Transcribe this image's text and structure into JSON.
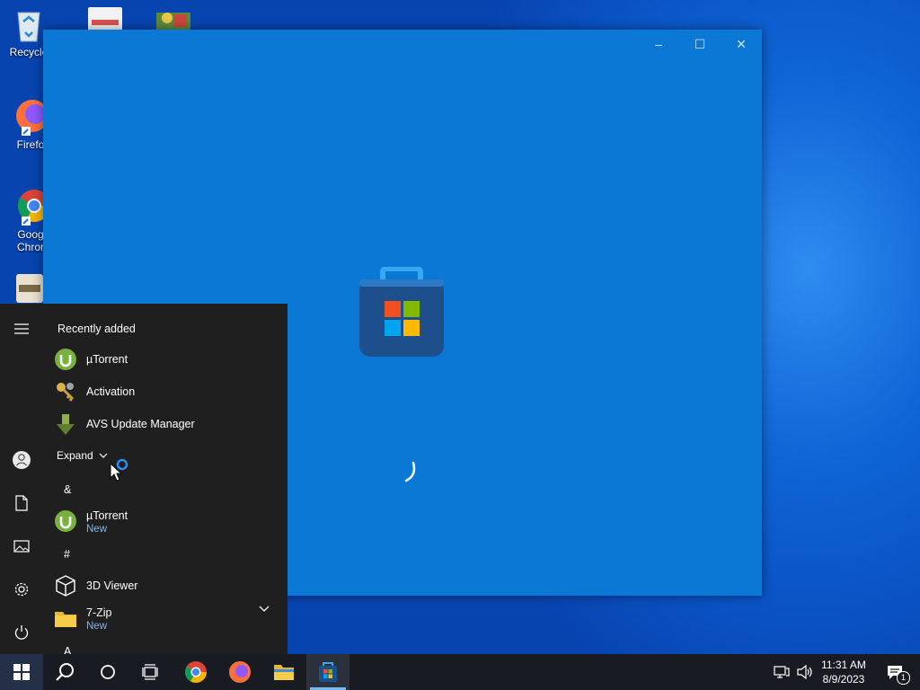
{
  "desktop": {
    "icons": [
      {
        "label": "Recycle"
      },
      {
        "label": "Firefo"
      },
      {
        "label": "Goog Chror"
      }
    ]
  },
  "store_window": {
    "controls": {
      "minimize": "–",
      "maximize": "☐",
      "close": "✕"
    }
  },
  "start_menu": {
    "recently_added_header": "Recently added",
    "recent": [
      {
        "name": "µTorrent"
      },
      {
        "name": "Activation"
      },
      {
        "name": "AVS Update Manager"
      }
    ],
    "expand_label": "Expand",
    "groups": [
      {
        "letter": "&"
      },
      {
        "letter": "#"
      },
      {
        "letter": "A"
      }
    ],
    "apps": [
      {
        "name": "µTorrent",
        "badge": "New"
      },
      {
        "name": "3D Viewer"
      },
      {
        "name": "7-Zip",
        "badge": "New"
      }
    ]
  },
  "taskbar": {
    "clock_time": "11:31 AM",
    "clock_date": "8/9/2023",
    "notification_count": "1"
  },
  "colors": {
    "desktop_blue": "#0a52c4",
    "store_window": "#0b78d6",
    "start_bg": "#1f1f1f",
    "taskbar_bg": "#181b22",
    "new_badge": "#7eb8f2"
  }
}
